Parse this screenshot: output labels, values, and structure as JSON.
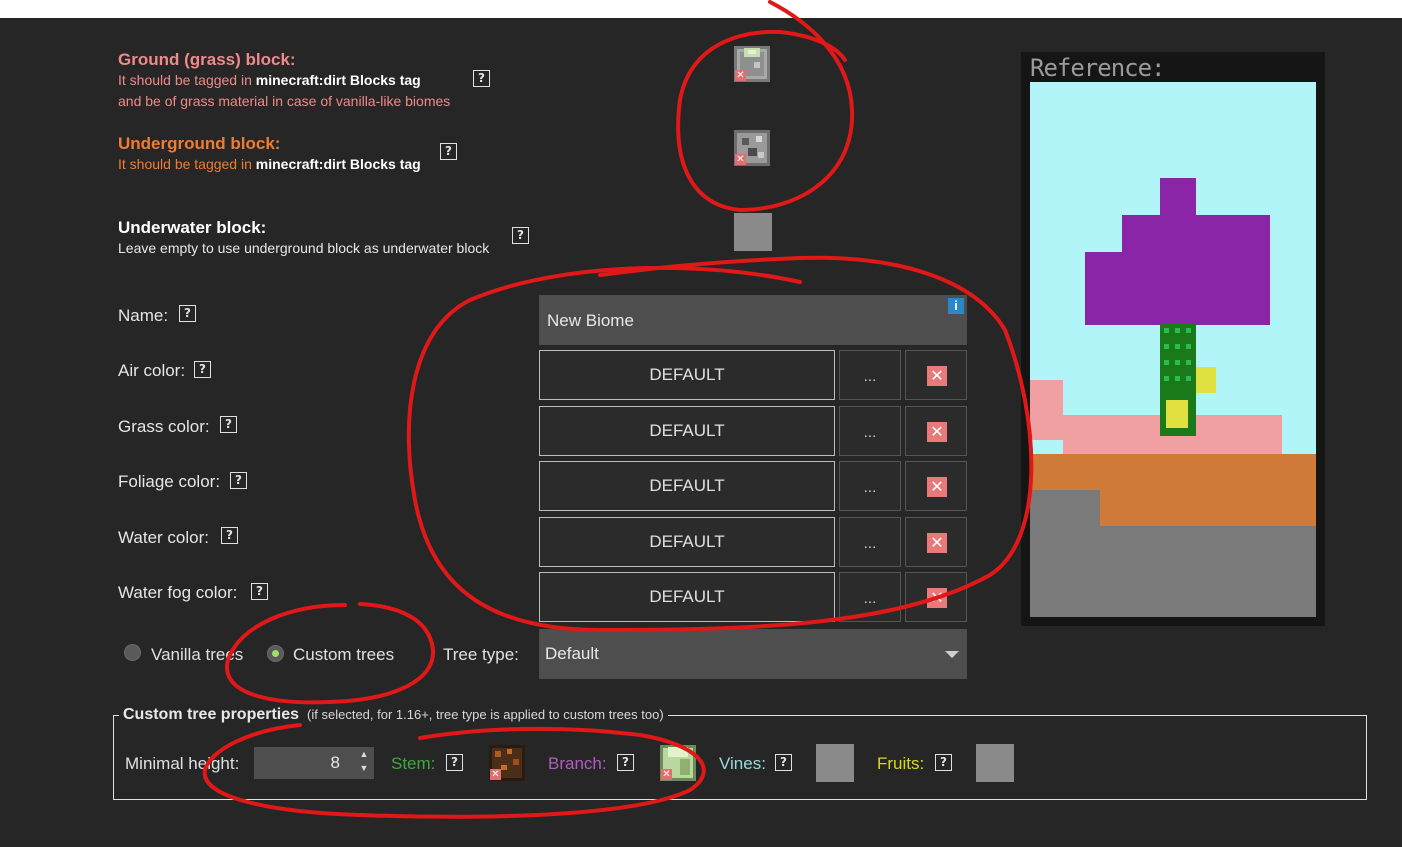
{
  "blocks": {
    "ground": {
      "title": "Ground (grass) block:",
      "desc_pre": "It should be tagged in ",
      "desc_tag": "minecraft:dirt Blocks tag",
      "desc_line2": "and be of grass material in case of vanilla-like biomes",
      "color": "#f08a8a"
    },
    "underground": {
      "title": "Underground block:",
      "desc_pre": "It should be tagged in ",
      "desc_tag": "minecraft:dirt Blocks tag",
      "color": "#f07c32"
    },
    "underwater": {
      "title": "Underwater block:",
      "desc": "Leave empty to use underground block as underwater block",
      "color": "#ffffff"
    }
  },
  "help_glyph": "?",
  "remove_glyph": "✕",
  "name": {
    "label": "Name:",
    "value": "New Biome",
    "info": "i"
  },
  "colors": [
    {
      "label": "Air color:",
      "value": "DEFAULT",
      "dots": "..."
    },
    {
      "label": "Grass color:",
      "value": "DEFAULT",
      "dots": "..."
    },
    {
      "label": "Foliage color:",
      "value": "DEFAULT",
      "dots": "..."
    },
    {
      "label": "Water color:",
      "value": "DEFAULT",
      "dots": "..."
    },
    {
      "label": "Water fog color:",
      "value": "DEFAULT",
      "dots": "..."
    }
  ],
  "trees": {
    "vanilla_label": "Vanilla trees",
    "custom_label": "Custom trees",
    "selected": "custom",
    "tree_type_label": "Tree type:",
    "tree_type_value": "Default"
  },
  "custom_tree": {
    "title": "Custom tree properties",
    "note": "(if selected, for 1.16+, tree type is applied to custom trees too)",
    "min_height_label": "Minimal height:",
    "min_height_value": "8",
    "stem_label": "Stem:",
    "branch_label": "Branch:",
    "vines_label": "Vines:",
    "fruits_label": "Fruits:",
    "colors": {
      "stem": "#3fa83f",
      "branch": "#b05cc0",
      "vines": "#9adada",
      "fruits": "#d8d820"
    }
  },
  "reference": {
    "title": "Reference:"
  },
  "annotation_color": "#e01818"
}
